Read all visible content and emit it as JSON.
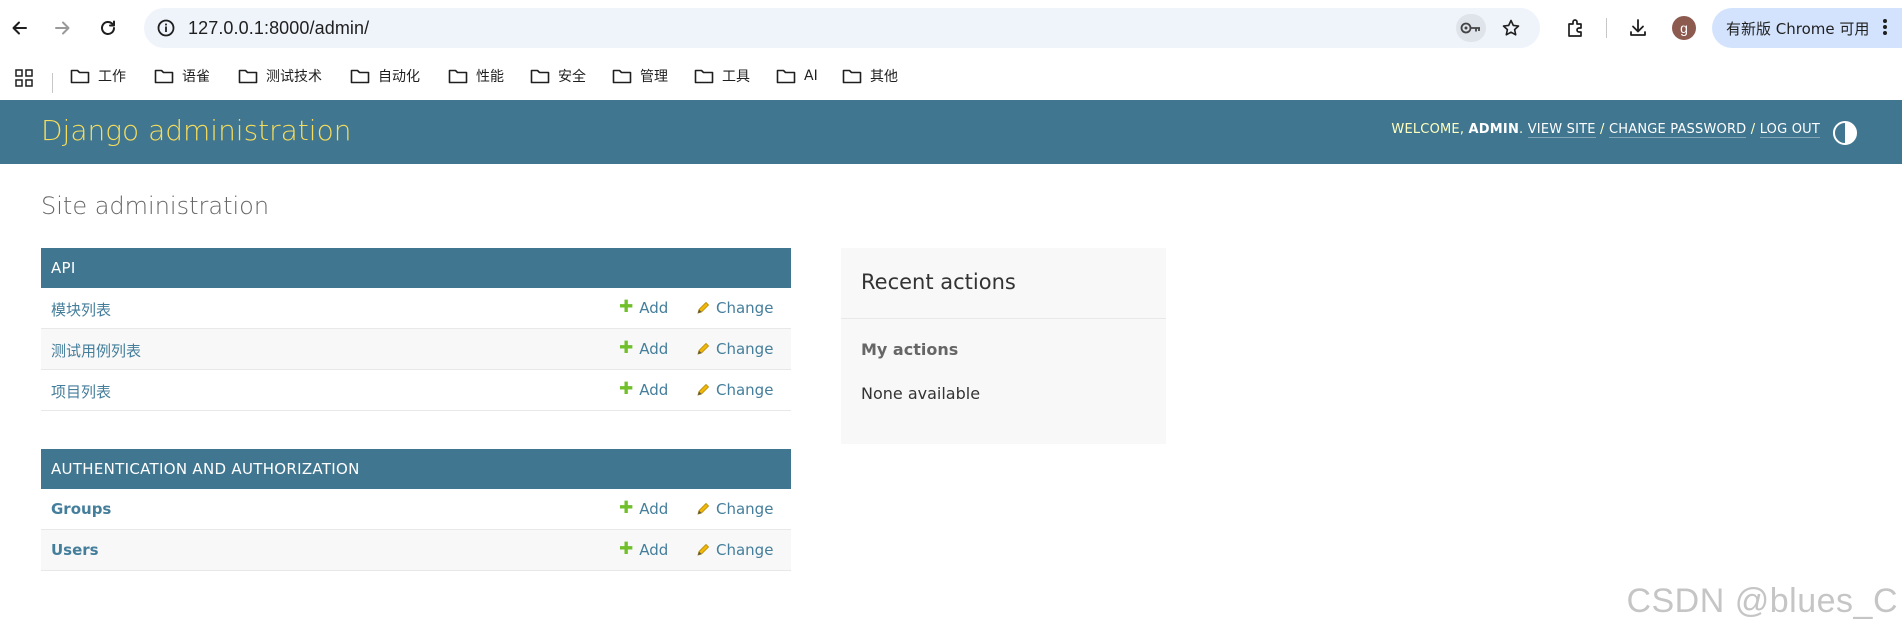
{
  "browser": {
    "url": "127.0.0.1:8000/admin/",
    "profile_initial": "g",
    "update_label": "有新版 Chrome 可用",
    "bookmarks": [
      {
        "label": "工作"
      },
      {
        "label": "语雀"
      },
      {
        "label": "测试技术"
      },
      {
        "label": "自动化"
      },
      {
        "label": "性能"
      },
      {
        "label": "安全"
      },
      {
        "label": "管理"
      },
      {
        "label": "工具"
      },
      {
        "label": "AI"
      },
      {
        "label": "其他"
      }
    ]
  },
  "header": {
    "branding": "Django administration",
    "welcome": "WELCOME, ",
    "username": "ADMIN",
    "period": ".",
    "view_site": "VIEW SITE",
    "change_password": "CHANGE PASSWORD",
    "log_out": "LOG OUT",
    "sep": "/"
  },
  "content": {
    "title": "Site administration",
    "add_label": "Add",
    "change_label": "Change",
    "apps": [
      {
        "caption": "API",
        "models": [
          {
            "name": "模块列表"
          },
          {
            "name": "测试用例列表"
          },
          {
            "name": "项目列表"
          }
        ]
      },
      {
        "caption": "AUTHENTICATION AND AUTHORIZATION",
        "models": [
          {
            "name": "Groups"
          },
          {
            "name": "Users"
          }
        ]
      }
    ]
  },
  "recent_actions": {
    "title": "Recent actions",
    "subtitle": "My actions",
    "empty": "None available"
  },
  "watermark": "CSDN @blues_C",
  "colors": {
    "header_bg": "#417690",
    "branding": "#f5dd5d",
    "link": "#447e9b",
    "add_icon": "#70bf2b",
    "change_icon": "#efb80b"
  }
}
